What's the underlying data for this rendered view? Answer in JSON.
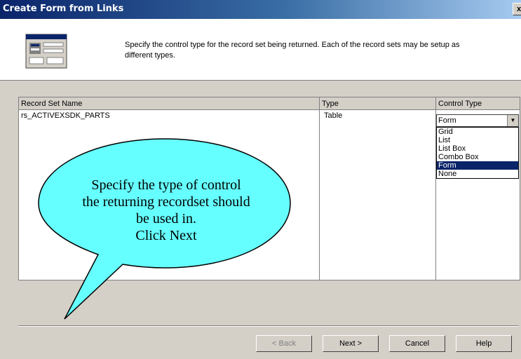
{
  "window": {
    "title": "Create Form from Links",
    "close_label": "x"
  },
  "header": {
    "instruction": "Specify the control type for the record set being returned. Each of the record sets may be setup as different types."
  },
  "grid": {
    "columns": [
      "Record Set Name",
      "Type",
      "Control Type"
    ],
    "rows": [
      {
        "name": "rs_ACTIVEXSDK_PARTS",
        "type": "Table",
        "control": "Form"
      }
    ]
  },
  "dropdown": {
    "options": [
      "Grid",
      "List",
      "List Box",
      "Combo Box",
      "Form",
      "None"
    ],
    "selected": "Form"
  },
  "callout": {
    "lines": [
      "Specify the type of control",
      "the returning recordset should",
      "be used in.",
      "Click Next"
    ],
    "fill": "#66ffff"
  },
  "buttons": {
    "back": "< Back",
    "next": "Next >",
    "cancel": "Cancel",
    "help": "Help"
  },
  "colors": {
    "title_bar": "#0a246a",
    "selection": "#0a246a",
    "dialog_bg": "#d4d0c8"
  }
}
